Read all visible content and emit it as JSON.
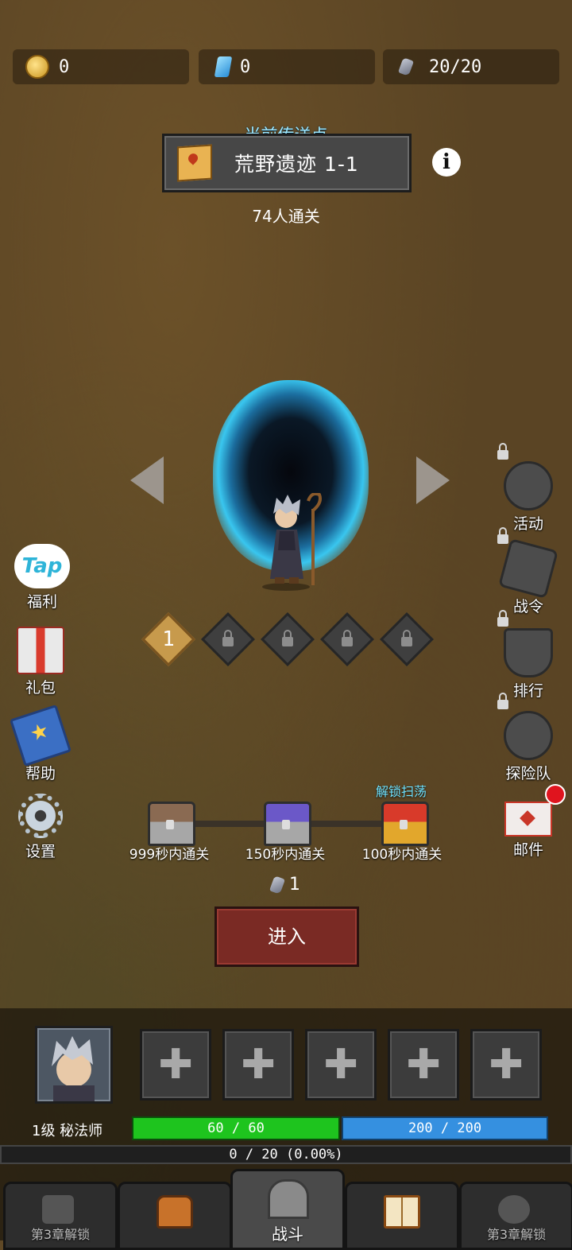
{
  "resources": {
    "coins": "0",
    "gems": "0",
    "stamina": "20/20"
  },
  "portal": {
    "label": "当前传送点",
    "title": "荒野遗迹 1-1",
    "cleared_count": "74人通关"
  },
  "stages": {
    "current": "1"
  },
  "left_menu": {
    "tap": "福利",
    "tap_logo": "Tap",
    "gift": "礼包",
    "help": "帮助",
    "settings": "设置"
  },
  "right_menu": {
    "event": "活动",
    "battle_pass": "战令",
    "ranking": "排行",
    "team": "探险队",
    "mail": "邮件"
  },
  "chests": {
    "unlock_label": "解锁扫荡",
    "items": [
      "999秒内通关",
      "150秒内通关",
      "100秒内通关"
    ]
  },
  "enter": {
    "cost": "1",
    "label": "进入"
  },
  "hero": {
    "level_class": "1级 秘法师",
    "hp": "60 / 60",
    "mp": "200 / 200",
    "xp": "0 / 20 (0.00%)"
  },
  "bottom_nav": {
    "left_locked": "第3章解锁",
    "battle": "战斗",
    "right_locked": "第3章解锁"
  },
  "colors": {
    "hp_bar": "#1ec41e",
    "mp_bar": "#3590e0",
    "enter_button": "#7a2a24",
    "portal_glow": "#39c6ef",
    "notification": "#e0141e"
  },
  "icons": [
    "coin-icon",
    "gem-icon",
    "stamina-stone-icon",
    "map-icon",
    "info-icon",
    "lock-icon",
    "gift-icon",
    "book-icon",
    "gear-icon",
    "helmet-icon",
    "badge-icon",
    "trophy-icon",
    "compass-icon",
    "mail-icon",
    "chest-icon",
    "backpack-icon",
    "castle-gate-icon",
    "spellbook-icon",
    "plus-icon"
  ]
}
